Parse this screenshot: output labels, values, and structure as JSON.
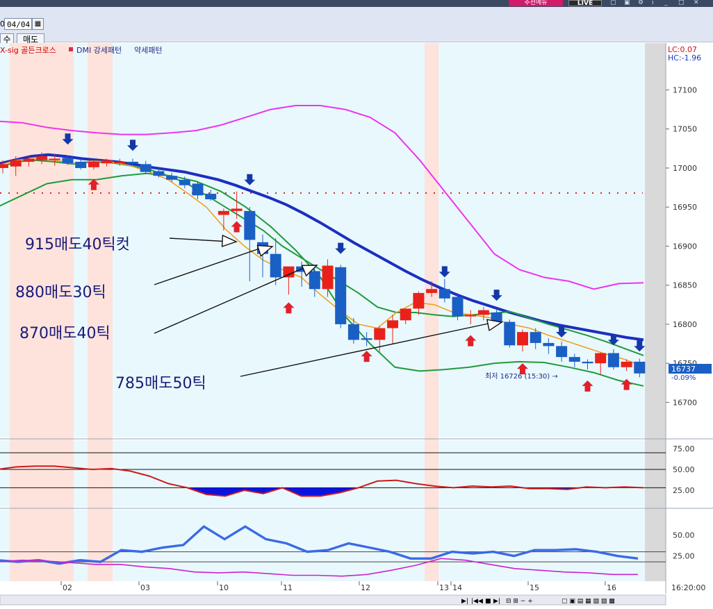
{
  "window": {
    "recommend_label": "추천메뉴",
    "live_label": "LIVE",
    "date_prefix": "0",
    "date_value": "04/04",
    "buy_tab": "수",
    "sell_tab": "매도"
  },
  "legend": {
    "items": [
      "X-sig 골든크로스",
      "DMI 강세패턴",
      "약세패턴"
    ],
    "colors": [
      "#cc0000",
      "#2a2a88",
      "#2a2a88"
    ]
  },
  "price_panel": {
    "lc_label": "LC:0.07",
    "hc_label": "HC:-1.96",
    "current_price": "16737",
    "change_pct": "-0.09%",
    "low_annotation": "최저 16726 (15:30) →"
  },
  "annotations": [
    {
      "text": "915매도40틱컷"
    },
    {
      "text": "880매도30틱"
    },
    {
      "text": "870매도40틱"
    },
    {
      "text": "785매도50틱"
    }
  ],
  "time_axis": {
    "labels": [
      "02",
      "03",
      "10",
      "11",
      "12",
      "13",
      "14",
      "15",
      "16"
    ],
    "current_time": "16:20:00"
  },
  "colors": {
    "panel_bg": "#e9f8fd",
    "session_shade": "#fde3dc",
    "up": "#e8221a",
    "down": "#1a5fc4",
    "ma_long": "#1c2fc0",
    "ma_mid": "#1f9a3a",
    "ma_short": "#f0a020",
    "band": "#ee33ee",
    "sig_down": "#1538a8",
    "sig_up": "#e0202a",
    "osc1_line": "#cc1a1a",
    "osc1_fill": "#0a14e0",
    "osc2_blue": "#3a6ae6",
    "osc2_magenta": "#cc22cc"
  },
  "chart_data": [
    {
      "type": "candlestick",
      "y_ticks": [
        17100,
        17050,
        17000,
        16950,
        16900,
        16850,
        16800,
        16750,
        16700
      ],
      "ylim": [
        16655,
        17160
      ],
      "candles": [
        {
          "o": 17000,
          "h": 17010,
          "l": 16993,
          "c": 17005
        },
        {
          "o": 17002,
          "h": 17015,
          "l": 16990,
          "c": 17010
        },
        {
          "o": 17008,
          "h": 17015,
          "l": 17002,
          "c": 17012
        },
        {
          "o": 17010,
          "h": 17020,
          "l": 17005,
          "c": 17015
        },
        {
          "o": 17012,
          "h": 17018,
          "l": 17003,
          "c": 17012
        },
        {
          "o": 17013,
          "h": 17016,
          "l": 17004,
          "c": 17006
        },
        {
          "o": 17008,
          "h": 17012,
          "l": 16998,
          "c": 17000
        },
        {
          "o": 17001,
          "h": 17010,
          "l": 16998,
          "c": 17008
        },
        {
          "o": 17006,
          "h": 17012,
          "l": 17002,
          "c": 17010
        },
        {
          "o": 17008,
          "h": 17012,
          "l": 17003,
          "c": 17008
        },
        {
          "o": 17008,
          "h": 17012,
          "l": 17003,
          "c": 17006
        },
        {
          "o": 17005,
          "h": 17009,
          "l": 16992,
          "c": 16995
        },
        {
          "o": 16996,
          "h": 17000,
          "l": 16988,
          "c": 16990
        },
        {
          "o": 16990,
          "h": 16994,
          "l": 16982,
          "c": 16985
        },
        {
          "o": 16985,
          "h": 16989,
          "l": 16974,
          "c": 16978
        },
        {
          "o": 16980,
          "h": 16983,
          "l": 16960,
          "c": 16965
        },
        {
          "o": 16967,
          "h": 16972,
          "l": 16958,
          "c": 16960
        },
        {
          "o": 16940,
          "h": 16948,
          "l": 16920,
          "c": 16945
        },
        {
          "o": 16945,
          "h": 16970,
          "l": 16935,
          "c": 16948
        },
        {
          "o": 16945,
          "h": 16950,
          "l": 16855,
          "c": 16908
        },
        {
          "o": 16905,
          "h": 16915,
          "l": 16860,
          "c": 16890
        },
        {
          "o": 16890,
          "h": 16910,
          "l": 16850,
          "c": 16860
        },
        {
          "o": 16860,
          "h": 16872,
          "l": 16838,
          "c": 16874
        },
        {
          "o": 16874,
          "h": 16880,
          "l": 16848,
          "c": 16867
        },
        {
          "o": 16868,
          "h": 16873,
          "l": 16835,
          "c": 16845
        },
        {
          "o": 16845,
          "h": 16883,
          "l": 16835,
          "c": 16875
        },
        {
          "o": 16873,
          "h": 16876,
          "l": 16795,
          "c": 16800
        },
        {
          "o": 16800,
          "h": 16808,
          "l": 16775,
          "c": 16780
        },
        {
          "o": 16782,
          "h": 16790,
          "l": 16772,
          "c": 16780
        },
        {
          "o": 16780,
          "h": 16797,
          "l": 16765,
          "c": 16795
        },
        {
          "o": 16795,
          "h": 16812,
          "l": 16775,
          "c": 16805
        },
        {
          "o": 16805,
          "h": 16818,
          "l": 16800,
          "c": 16820
        },
        {
          "o": 16820,
          "h": 16842,
          "l": 16812,
          "c": 16840
        },
        {
          "o": 16840,
          "h": 16855,
          "l": 16835,
          "c": 16845
        },
        {
          "o": 16845,
          "h": 16858,
          "l": 16828,
          "c": 16833
        },
        {
          "o": 16835,
          "h": 16840,
          "l": 16805,
          "c": 16810
        },
        {
          "o": 16810,
          "h": 16818,
          "l": 16800,
          "c": 16812
        },
        {
          "o": 16812,
          "h": 16822,
          "l": 16805,
          "c": 16818
        },
        {
          "o": 16815,
          "h": 16820,
          "l": 16798,
          "c": 16803
        },
        {
          "o": 16803,
          "h": 16806,
          "l": 16770,
          "c": 16773
        },
        {
          "o": 16773,
          "h": 16793,
          "l": 16765,
          "c": 16790
        },
        {
          "o": 16790,
          "h": 16795,
          "l": 16768,
          "c": 16776
        },
        {
          "o": 16776,
          "h": 16782,
          "l": 16762,
          "c": 16772
        },
        {
          "o": 16772,
          "h": 16778,
          "l": 16752,
          "c": 16758
        },
        {
          "o": 16758,
          "h": 16762,
          "l": 16745,
          "c": 16752
        },
        {
          "o": 16752,
          "h": 16755,
          "l": 16742,
          "c": 16750
        },
        {
          "o": 16750,
          "h": 16764,
          "l": 16736,
          "c": 16763
        },
        {
          "o": 16763,
          "h": 16768,
          "l": 16742,
          "c": 16745
        },
        {
          "o": 16745,
          "h": 16755,
          "l": 16740,
          "c": 16752
        },
        {
          "o": 16752,
          "h": 16756,
          "l": 16732,
          "c": 16737
        }
      ],
      "ma_long": [
        17005,
        17010,
        17015,
        17017,
        17015,
        17012,
        17010,
        17008,
        17005,
        17001,
        16998,
        16995,
        16990,
        16985,
        16978,
        16970,
        16962,
        16953,
        16942,
        16930,
        16917,
        16904,
        16892,
        16880,
        16868,
        16857,
        16847,
        16838,
        16830,
        16823,
        16816,
        16810,
        16804,
        16799,
        16795,
        16791,
        16787,
        16783,
        16780
      ],
      "ma_mid": [
        17000,
        17008,
        17010,
        17008,
        17005,
        17008,
        17007,
        17003,
        16998,
        16990,
        16980,
        16965,
        16950,
        16935,
        16920,
        16900,
        16885,
        16870,
        16855,
        16840,
        16822,
        16815,
        16815,
        16812,
        16810,
        16812,
        16814,
        16816,
        16808,
        16800,
        16793,
        16786,
        16778,
        16769,
        16760
      ],
      "ma_short": [
        17003,
        17010,
        17012,
        17010,
        17006,
        17009,
        17008,
        17003,
        16995,
        16985,
        16968,
        16950,
        16922,
        16900,
        16882,
        16870,
        16860,
        16838,
        16818,
        16800,
        16795,
        16815,
        16828,
        16825,
        16815,
        16812,
        16808,
        16800,
        16795,
        16786,
        16778,
        16770,
        16762,
        16755,
        16746
      ],
      "bb_upper": [
        17060,
        17058,
        17052,
        17048,
        17045,
        17043,
        17043,
        17045,
        17048,
        17055,
        17065,
        17075,
        17080,
        17080,
        17075,
        17065,
        17045,
        17010,
        16970,
        16930,
        16890,
        16870,
        16860,
        16855,
        16845,
        16852,
        16853
      ],
      "bb_lower": [
        16950,
        16965,
        16980,
        16985,
        16985,
        16990,
        16993,
        16990,
        16983,
        16970,
        16950,
        16925,
        16895,
        16860,
        16810,
        16775,
        16745,
        16740,
        16742,
        16745,
        16750,
        16752,
        16751,
        16745,
        16738,
        16728,
        16721
      ],
      "ref_level": 16968,
      "low_marker": 16726,
      "current_price": 16737
    },
    {
      "type": "area",
      "y_ticks": [
        75.0,
        50.0,
        25.0
      ],
      "ylim": [
        5,
        85
      ],
      "levels": [
        70,
        50,
        28
      ],
      "series": [
        {
          "values": [
            50,
            53,
            54,
            54,
            52,
            50,
            51,
            48,
            42,
            33,
            28,
            20,
            18,
            25,
            21,
            28,
            18,
            18,
            22,
            28,
            36,
            37,
            33,
            30,
            28,
            30,
            29,
            30,
            27,
            27,
            26,
            29,
            28,
            29,
            28
          ]
        }
      ]
    },
    {
      "type": "line",
      "y_ticks": [
        50.0,
        25.0
      ],
      "ylim": [
        -5,
        80
      ],
      "levels": [
        30,
        18
      ],
      "series": [
        {
          "values": [
            20,
            18,
            20,
            16,
            20,
            18,
            32,
            30,
            35,
            38,
            60,
            45,
            60,
            45,
            40,
            30,
            32,
            40,
            35,
            30,
            22,
            22,
            30,
            28,
            30,
            25,
            32,
            32,
            33,
            30,
            25,
            22
          ]
        },
        {
          "values": [
            18,
            20,
            19,
            17,
            15,
            15,
            12,
            10,
            6,
            5,
            6,
            4,
            2,
            2,
            1,
            3,
            8,
            14,
            22,
            20,
            15,
            10,
            8,
            6,
            5,
            3,
            3
          ]
        }
      ]
    }
  ]
}
